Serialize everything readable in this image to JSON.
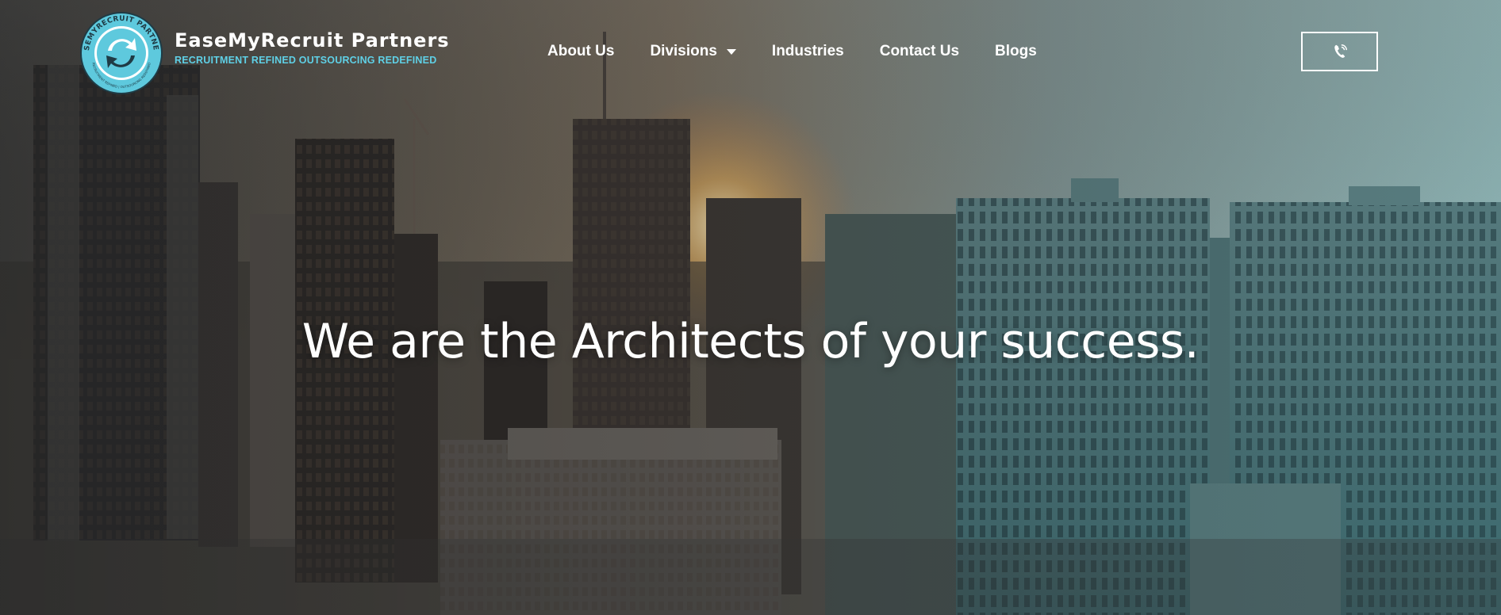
{
  "brand": {
    "name": "EaseMyRecruit Partners",
    "tagline": "RECRUITMENT REFINED OUTSOURCING REDEFINED",
    "badge_ring_text": "EASEMYRECRUIT PARTNERS",
    "badge_lower_text": "RECRUITMENT REFINED | OUTSOURCING REDEFINED",
    "accent_color": "#5fd0e6"
  },
  "nav": {
    "items": [
      {
        "label": "About Us",
        "has_dropdown": false
      },
      {
        "label": "Divisions",
        "has_dropdown": true
      },
      {
        "label": "Industries",
        "has_dropdown": false
      },
      {
        "label": "Contact Us",
        "has_dropdown": false
      },
      {
        "label": "Blogs",
        "has_dropdown": false
      }
    ]
  },
  "call_button": {
    "icon": "phone-ringing-icon"
  },
  "hero": {
    "headline": "We are the Architects of your success."
  }
}
